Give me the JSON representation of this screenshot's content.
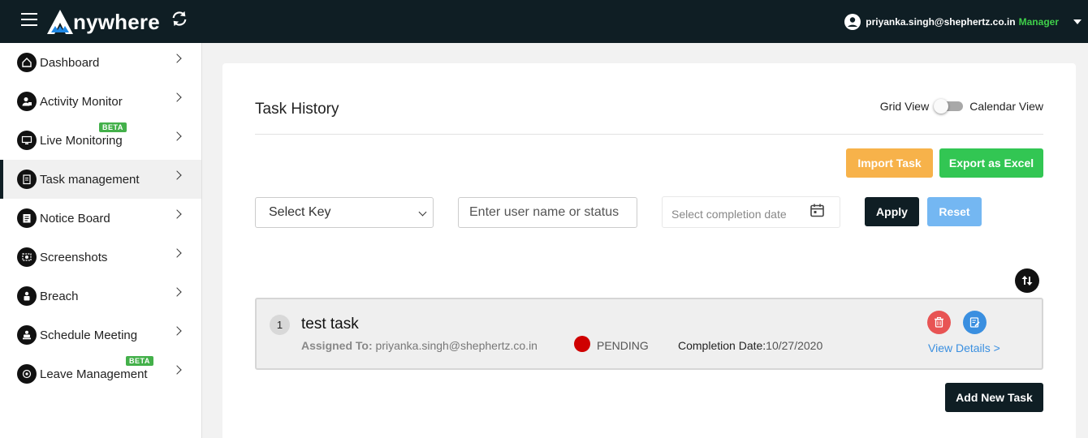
{
  "header": {
    "app_name": "nywhere",
    "user_email": "priyanka.singh@shephertz.co.in",
    "user_role": "Manager"
  },
  "sidebar": {
    "items": [
      {
        "label": "Dashboard",
        "icon": "home-icon"
      },
      {
        "label": "Activity Monitor",
        "icon": "user-activity-icon"
      },
      {
        "label": "Live Monitoring",
        "icon": "live-monitor-icon",
        "badge": "BETA"
      },
      {
        "label": "Task management",
        "icon": "clipboard-icon",
        "active": true
      },
      {
        "label": "Notice Board",
        "icon": "notice-icon"
      },
      {
        "label": "Screenshots",
        "icon": "screenshot-icon"
      },
      {
        "label": "Breach",
        "icon": "breach-icon"
      },
      {
        "label": "Schedule Meeting",
        "icon": "meeting-icon"
      },
      {
        "label": "Leave Management",
        "icon": "leave-icon",
        "badge": "BETA"
      }
    ]
  },
  "main": {
    "title": "Task History",
    "view_toggle": {
      "left_label": "Grid View",
      "right_label": "Calendar View"
    },
    "import_label": "Import Task",
    "export_label": "Export as Excel",
    "filters": {
      "select_value": "Select Key",
      "search_placeholder": "Enter user name or status",
      "date_placeholder": "Select completion date",
      "apply_label": "Apply",
      "reset_label": "Reset"
    },
    "tasks": [
      {
        "number": "1",
        "title": "test task",
        "assigned_label": "Assigned To:",
        "assigned_to": "priyanka.singh@shephertz.co.in",
        "status": "PENDING",
        "completion_label": "Completion Date:",
        "completion_date": "10/27/2020",
        "view_details_label": "View Details >"
      }
    ],
    "add_task_label": "Add New Task"
  },
  "colors": {
    "topbar": "#0f1e24",
    "role": "#3fcf4a",
    "import": "#f7b24a",
    "export": "#32c653",
    "reset": "#74b7f2",
    "status_pending": "#cf0000",
    "link": "#3a8fe0"
  }
}
